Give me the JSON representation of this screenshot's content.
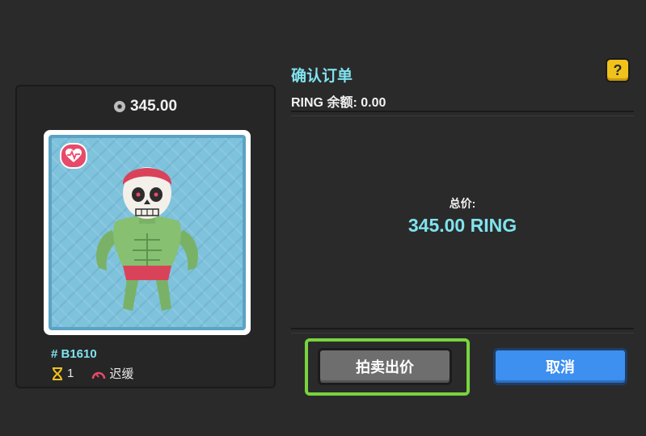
{
  "card": {
    "price": "345.00",
    "id": "# B1610",
    "generation": "1",
    "speed": "迟缓"
  },
  "order": {
    "title": "确认订单",
    "help_label": "?",
    "balance": "RING 余额: 0.00",
    "total_label": "总价:",
    "total_value": "345.00 RING"
  },
  "buttons": {
    "bid_label": "拍卖出价",
    "cancel_label": "取消"
  },
  "colors": {
    "accent": "#7fe3ef",
    "bid_button": "#6e6e6e",
    "cancel_button": "#3d8ff0",
    "highlight": "#78d43e",
    "help_button": "#f1c21b"
  }
}
